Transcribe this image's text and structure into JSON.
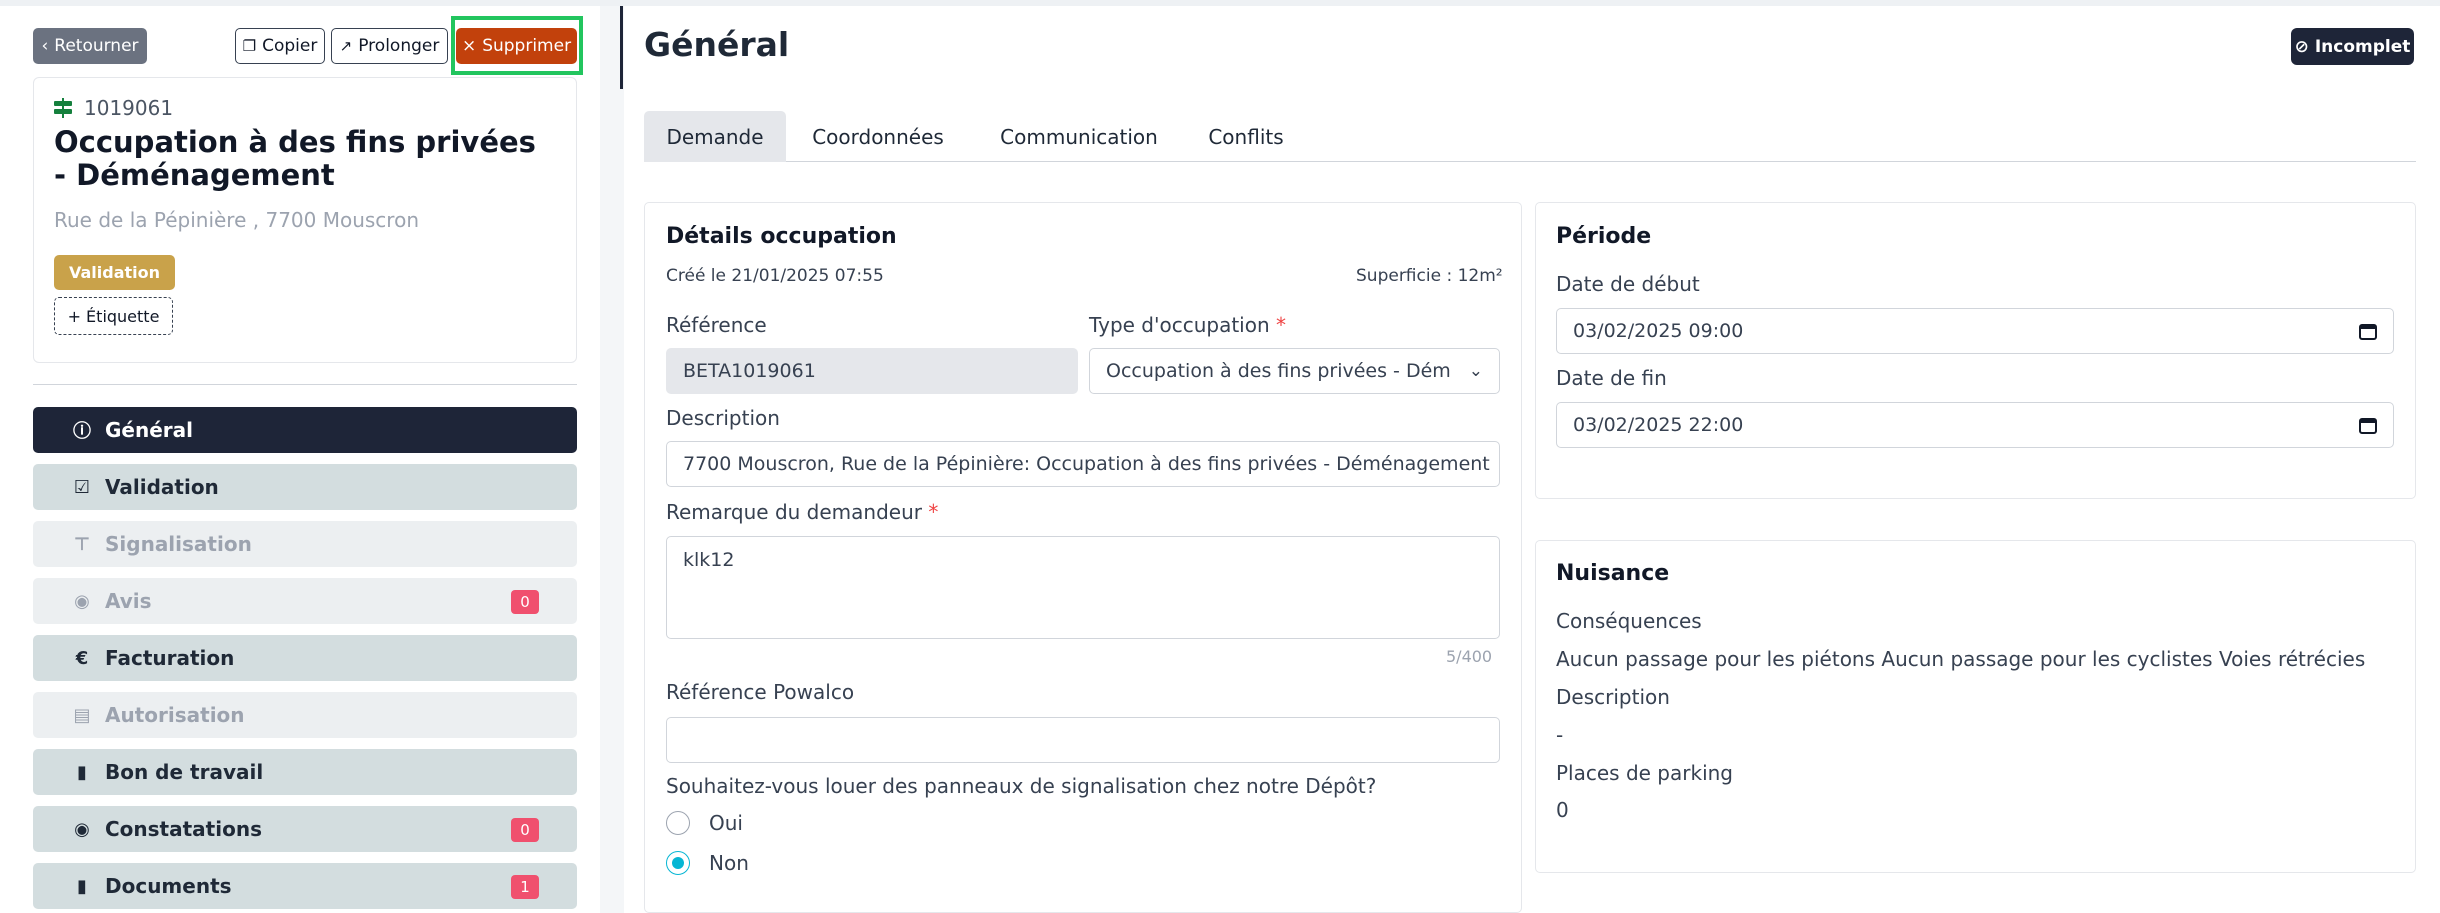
{
  "header": {
    "back_label": "Retourner",
    "copy_label": "Copier",
    "prolong_label": "Prolonger",
    "delete_label": "Supprimer"
  },
  "card": {
    "reference": "1019061",
    "title": "Occupation à des fins privées - Déménagement",
    "address": "Rue de la Pépinière , 7700 Mouscron",
    "status_badge": "Validation",
    "add_tag_label": "+ Étiquette"
  },
  "nav": [
    {
      "label": "Général",
      "icon": "info-icon",
      "count": ""
    },
    {
      "label": "Validation",
      "icon": "checklist-icon",
      "count": ""
    },
    {
      "label": "Signalisation",
      "icon": "signpost-icon",
      "count": ""
    },
    {
      "label": "Avis",
      "icon": "comment-icon",
      "count": "0"
    },
    {
      "label": "Facturation",
      "icon": "euro-icon",
      "count": ""
    },
    {
      "label": "Autorisation",
      "icon": "file-lock-icon",
      "count": ""
    },
    {
      "label": "Bon de travail",
      "icon": "file-icon",
      "count": ""
    },
    {
      "label": "Constatations",
      "icon": "eye-icon",
      "count": "0"
    },
    {
      "label": "Documents",
      "icon": "file-icon",
      "count": "1"
    }
  ],
  "page": {
    "title": "Général",
    "status": "Incomplet"
  },
  "tabs": [
    "Demande",
    "Coordonnées",
    "Communication",
    "Conflits"
  ],
  "details": {
    "heading": "Détails occupation",
    "created": "Créé le 21/01/2025 07:55",
    "area": "Superficie : 12m²",
    "reference_label": "Référence",
    "reference_value": "BETA1019061",
    "type_label": "Type d'occupation",
    "type_value": "Occupation à des fins privées - Dém",
    "description_label": "Description",
    "description_value": "7700 Mouscron, Rue de la Pépinière: Occupation à des fins privées - Déménagement",
    "remark_label": "Remarque du demandeur",
    "remark_value": "klk12",
    "remark_counter": "5/400",
    "powalco_label": "Référence Powalco",
    "powalco_value": "",
    "rent_question": "Souhaitez-vous louer des panneaux de signalisation chez notre Dépôt?",
    "option_yes": "Oui",
    "option_no": "Non",
    "required_mark": "*"
  },
  "period": {
    "heading": "Période",
    "start_label": "Date de début",
    "start_value": "03/02/2025 09:00",
    "end_label": "Date de fin",
    "end_value": "03/02/2025 22:00"
  },
  "nuisance": {
    "heading": "Nuisance",
    "consequences_label": "Conséquences",
    "consequences_value": "Aucun passage pour les piétons Aucun passage pour les cyclistes Voies rétrécies",
    "description_label": "Description",
    "description_value": "-",
    "parking_label": "Places de parking",
    "parking_value": "0"
  }
}
